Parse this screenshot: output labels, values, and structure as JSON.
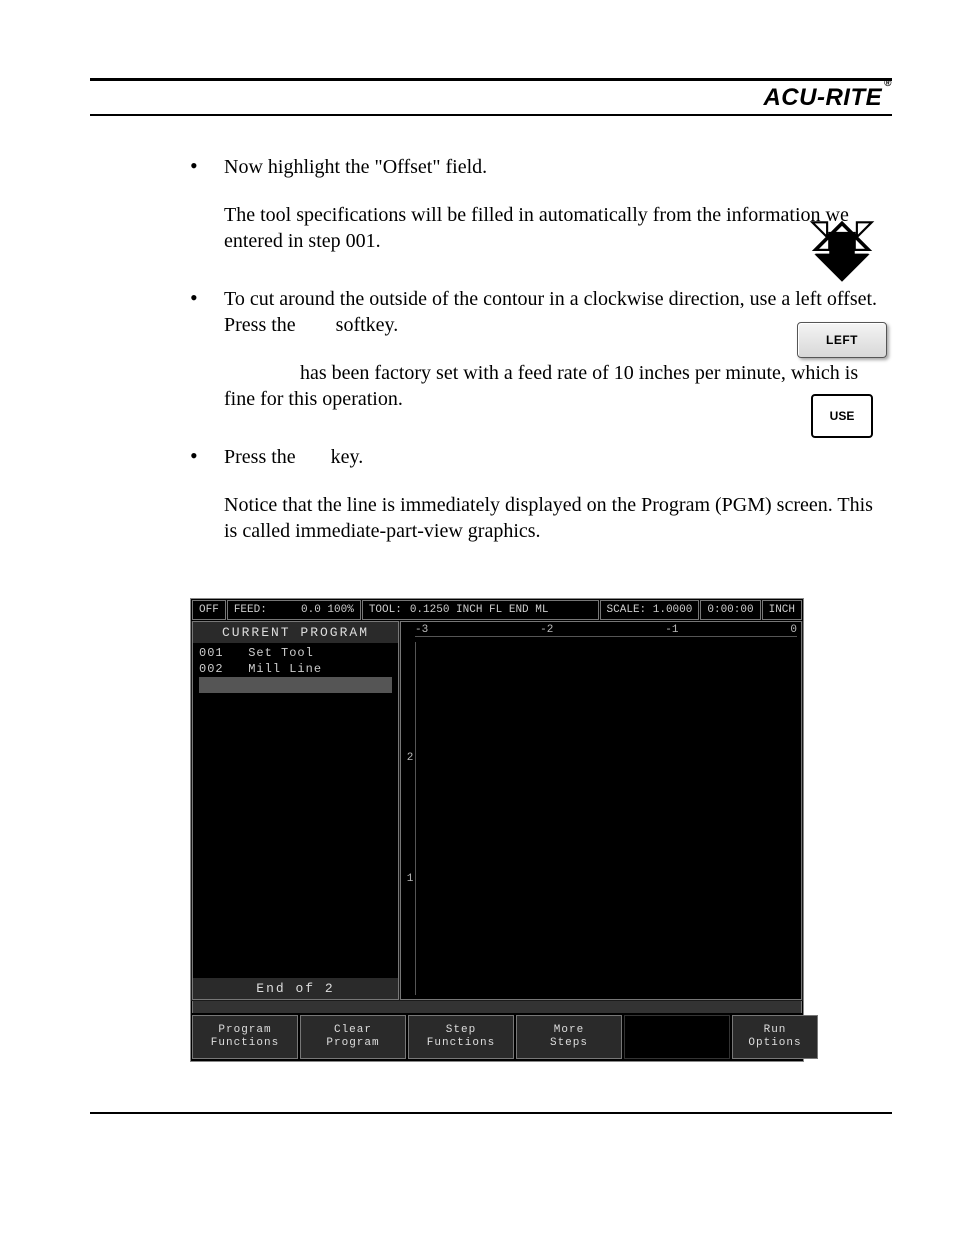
{
  "brand": "ACU-RITE",
  "brand_mark": "®",
  "bullets": {
    "b1": {
      "line": "Now highlight the \"Offset\" field.",
      "para": "The tool specifications will be filled in automatically from the information we entered in step 001."
    },
    "b2": {
      "line1": "To cut around the outside of the contour in a clockwise direction, use a left offset. Press the",
      "line1_after": "softkey.",
      "para": "has been factory set with a feed rate of 10 inches per minute, which is fine for this operation."
    },
    "b3": {
      "line": "Press the",
      "line_after": "key.",
      "para": "Notice that the line is immediately displayed on the Program (PGM) screen. This is called immediate-part-view graphics."
    }
  },
  "side": {
    "left_label": "LEFT",
    "use_label": "USE"
  },
  "screen": {
    "top": {
      "off": "OFF",
      "feed_label": "FEED:",
      "feed_val": "0.0 100%",
      "tool_label": "TOOL:",
      "tool_val": "0.1250 INCH FL END ML",
      "scale": "SCALE: 1.0000",
      "time": "0:00:00",
      "unit": "INCH"
    },
    "left_panel": {
      "title": "Current Program",
      "row1_num": "001",
      "row1_name": "Set Tool",
      "row2_num": "002",
      "row2_name": "Mill Line",
      "footer": "End of 2"
    },
    "ruler": {
      "x": [
        "-3",
        "-2",
        "-1",
        "0"
      ],
      "y": [
        "",
        "2",
        "1",
        ""
      ]
    },
    "softkeys": {
      "k1a": "Program",
      "k1b": "Functions",
      "k2a": "Clear",
      "k2b": "Program",
      "k3a": "Step",
      "k3b": "Functions",
      "k4a": "More",
      "k4b": "Steps",
      "k5a": "Run",
      "k5b": "Options"
    }
  }
}
